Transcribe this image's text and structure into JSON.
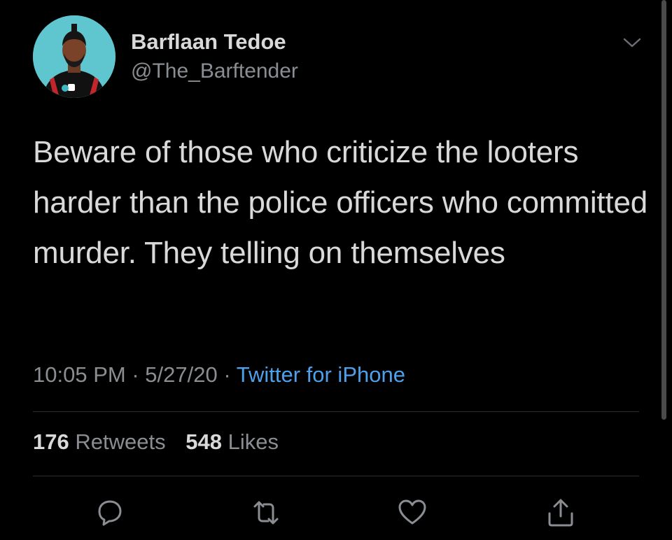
{
  "user": {
    "display_name": "Barflaan Tedoe",
    "handle": "@The_Barftender"
  },
  "tweet": {
    "text": "Beware of those who criticize the looters harder than the police officers who committed murder. They telling on themselves",
    "time": "10:05 PM",
    "date": "5/27/20",
    "separator": "·",
    "source": "Twitter for iPhone"
  },
  "stats": {
    "retweets_count": "176",
    "retweets_label": "Retweets",
    "likes_count": "548",
    "likes_label": "Likes"
  },
  "icons": {
    "avatar": "avatar-illustration",
    "caret": "chevron-down-icon",
    "reply": "reply-icon",
    "retweet": "retweet-icon",
    "like": "heart-icon",
    "share": "share-icon"
  },
  "colors": {
    "background": "#000000",
    "text": "#d9d9d9",
    "muted": "#8a8d91",
    "link": "#4ea0ea",
    "avatar_bg": "#5fc6d0"
  }
}
